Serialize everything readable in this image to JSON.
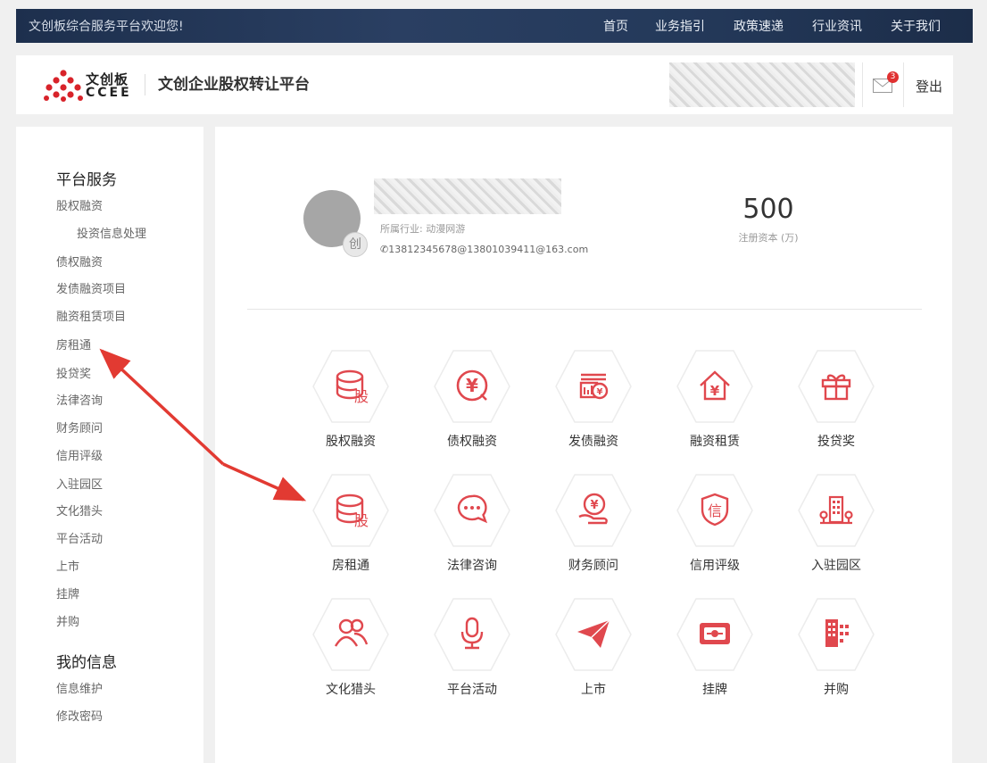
{
  "topbar": {
    "welcome": "文创板综合服务平台欢迎您!",
    "nav": [
      "首页",
      "业务指引",
      "政策速递",
      "行业资讯",
      "关于我们"
    ]
  },
  "header": {
    "logo_cn": "文创板",
    "logo_en": "CCEE",
    "platform_title": "文创企业股权转让平台",
    "mail_badge": "3",
    "logout": "登出"
  },
  "sidebar": {
    "section1": "平台服务",
    "items": [
      "股权融资",
      "投资信息处理",
      "债权融资",
      "发债融资项目",
      "融资租赁项目",
      "房租通",
      "投贷奖",
      "法律咨询",
      "财务顾问",
      "信用评级",
      "入驻园区",
      "文化猎头",
      "平台活动",
      "上市",
      "挂牌",
      "并购"
    ],
    "section2": "我的信息",
    "my_items": [
      "信息维护",
      "修改密码"
    ]
  },
  "profile": {
    "avatar_tag": "创",
    "industry": "所属行业: 动漫网游",
    "contact": "13812345678@13801039411@163.com",
    "capital_value": "500",
    "capital_label": "注册资本 (万)"
  },
  "services": [
    {
      "label": "股权融资",
      "icon": "equity-stack-icon"
    },
    {
      "label": "债权融资",
      "icon": "yuan-circle-icon"
    },
    {
      "label": "发债融资",
      "icon": "bond-yuan-icon"
    },
    {
      "label": "融资租赁",
      "icon": "house-yuan-icon"
    },
    {
      "label": "投贷奖",
      "icon": "gift-icon"
    },
    {
      "label": "房租通",
      "icon": "equity-stack-icon"
    },
    {
      "label": "法律咨询",
      "icon": "chat-bubble-icon"
    },
    {
      "label": "财务顾问",
      "icon": "hand-yuan-icon"
    },
    {
      "label": "信用评级",
      "icon": "shield-credit-icon"
    },
    {
      "label": "入驻园区",
      "icon": "building-park-icon"
    },
    {
      "label": "文化猎头",
      "icon": "people-icon"
    },
    {
      "label": "平台活动",
      "icon": "microphone-icon"
    },
    {
      "label": "上市",
      "icon": "paper-plane-icon"
    },
    {
      "label": "挂牌",
      "icon": "banknote-icon"
    },
    {
      "label": "并购",
      "icon": "buildings-icon"
    }
  ],
  "glyphs": {
    "equity": "股",
    "yuan": "¥",
    "credit": "信"
  },
  "colors": {
    "accent": "#e0484e",
    "topbar": "#24395a",
    "hex_border": "#ececec"
  }
}
